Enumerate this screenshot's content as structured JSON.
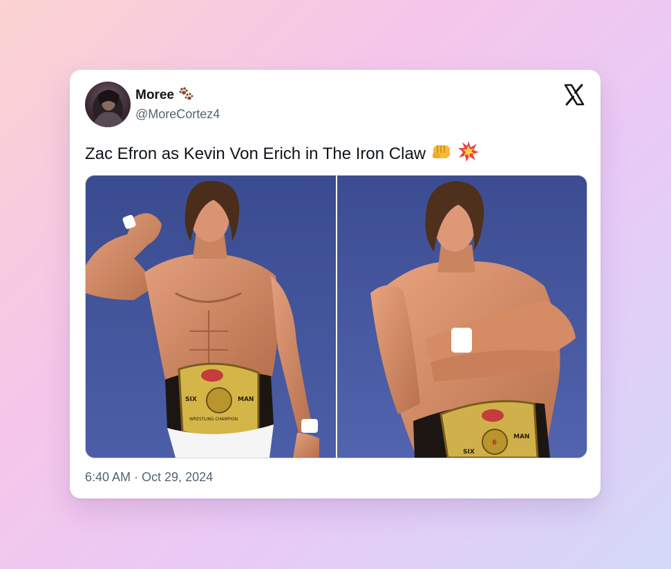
{
  "author": {
    "display_name": "Moree",
    "handle": "@MoreCortez4",
    "name_emoji_icon": "paw-prints-icon"
  },
  "tweet": {
    "text": "Zac Efron as Kevin Von Erich in The Iron Claw",
    "emoji_icons": [
      "oncoming-fist-icon",
      "collision-icon"
    ],
    "timestamp": "6:40 AM · Oct 29, 2024"
  },
  "media": {
    "photos": [
      {
        "subject": "wrestler flexing with championship belt"
      },
      {
        "subject": "wrestler with crossed arms and championship belt"
      }
    ],
    "belt_text_left": {
      "line1": "SIX",
      "line2": "MAN",
      "line3": "WRESTLING CHAMPION"
    },
    "belt_text_right": {
      "line1": "SIX",
      "line2": "MAN",
      "line3": "6"
    }
  },
  "colors": {
    "primary_text": "#0f1419",
    "secondary_text": "#536471",
    "photo_background": "#3f4f94"
  }
}
